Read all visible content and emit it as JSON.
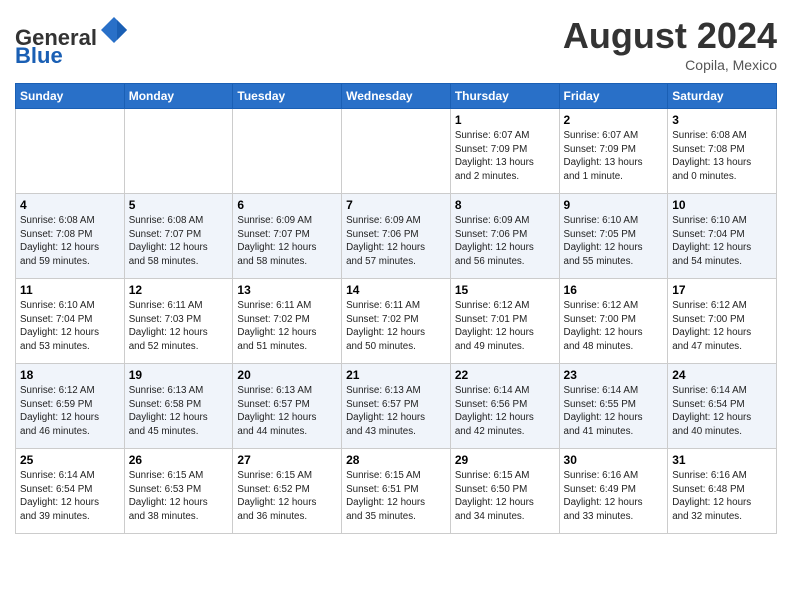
{
  "header": {
    "logo_line1": "General",
    "logo_line2": "Blue",
    "month_year": "August 2024",
    "location": "Copila, Mexico"
  },
  "days_of_week": [
    "Sunday",
    "Monday",
    "Tuesday",
    "Wednesday",
    "Thursday",
    "Friday",
    "Saturday"
  ],
  "weeks": [
    [
      {
        "day": "",
        "info": ""
      },
      {
        "day": "",
        "info": ""
      },
      {
        "day": "",
        "info": ""
      },
      {
        "day": "",
        "info": ""
      },
      {
        "day": "1",
        "info": "Sunrise: 6:07 AM\nSunset: 7:09 PM\nDaylight: 13 hours\nand 2 minutes."
      },
      {
        "day": "2",
        "info": "Sunrise: 6:07 AM\nSunset: 7:09 PM\nDaylight: 13 hours\nand 1 minute."
      },
      {
        "day": "3",
        "info": "Sunrise: 6:08 AM\nSunset: 7:08 PM\nDaylight: 13 hours\nand 0 minutes."
      }
    ],
    [
      {
        "day": "4",
        "info": "Sunrise: 6:08 AM\nSunset: 7:08 PM\nDaylight: 12 hours\nand 59 minutes."
      },
      {
        "day": "5",
        "info": "Sunrise: 6:08 AM\nSunset: 7:07 PM\nDaylight: 12 hours\nand 58 minutes."
      },
      {
        "day": "6",
        "info": "Sunrise: 6:09 AM\nSunset: 7:07 PM\nDaylight: 12 hours\nand 58 minutes."
      },
      {
        "day": "7",
        "info": "Sunrise: 6:09 AM\nSunset: 7:06 PM\nDaylight: 12 hours\nand 57 minutes."
      },
      {
        "day": "8",
        "info": "Sunrise: 6:09 AM\nSunset: 7:06 PM\nDaylight: 12 hours\nand 56 minutes."
      },
      {
        "day": "9",
        "info": "Sunrise: 6:10 AM\nSunset: 7:05 PM\nDaylight: 12 hours\nand 55 minutes."
      },
      {
        "day": "10",
        "info": "Sunrise: 6:10 AM\nSunset: 7:04 PM\nDaylight: 12 hours\nand 54 minutes."
      }
    ],
    [
      {
        "day": "11",
        "info": "Sunrise: 6:10 AM\nSunset: 7:04 PM\nDaylight: 12 hours\nand 53 minutes."
      },
      {
        "day": "12",
        "info": "Sunrise: 6:11 AM\nSunset: 7:03 PM\nDaylight: 12 hours\nand 52 minutes."
      },
      {
        "day": "13",
        "info": "Sunrise: 6:11 AM\nSunset: 7:02 PM\nDaylight: 12 hours\nand 51 minutes."
      },
      {
        "day": "14",
        "info": "Sunrise: 6:11 AM\nSunset: 7:02 PM\nDaylight: 12 hours\nand 50 minutes."
      },
      {
        "day": "15",
        "info": "Sunrise: 6:12 AM\nSunset: 7:01 PM\nDaylight: 12 hours\nand 49 minutes."
      },
      {
        "day": "16",
        "info": "Sunrise: 6:12 AM\nSunset: 7:00 PM\nDaylight: 12 hours\nand 48 minutes."
      },
      {
        "day": "17",
        "info": "Sunrise: 6:12 AM\nSunset: 7:00 PM\nDaylight: 12 hours\nand 47 minutes."
      }
    ],
    [
      {
        "day": "18",
        "info": "Sunrise: 6:12 AM\nSunset: 6:59 PM\nDaylight: 12 hours\nand 46 minutes."
      },
      {
        "day": "19",
        "info": "Sunrise: 6:13 AM\nSunset: 6:58 PM\nDaylight: 12 hours\nand 45 minutes."
      },
      {
        "day": "20",
        "info": "Sunrise: 6:13 AM\nSunset: 6:57 PM\nDaylight: 12 hours\nand 44 minutes."
      },
      {
        "day": "21",
        "info": "Sunrise: 6:13 AM\nSunset: 6:57 PM\nDaylight: 12 hours\nand 43 minutes."
      },
      {
        "day": "22",
        "info": "Sunrise: 6:14 AM\nSunset: 6:56 PM\nDaylight: 12 hours\nand 42 minutes."
      },
      {
        "day": "23",
        "info": "Sunrise: 6:14 AM\nSunset: 6:55 PM\nDaylight: 12 hours\nand 41 minutes."
      },
      {
        "day": "24",
        "info": "Sunrise: 6:14 AM\nSunset: 6:54 PM\nDaylight: 12 hours\nand 40 minutes."
      }
    ],
    [
      {
        "day": "25",
        "info": "Sunrise: 6:14 AM\nSunset: 6:54 PM\nDaylight: 12 hours\nand 39 minutes."
      },
      {
        "day": "26",
        "info": "Sunrise: 6:15 AM\nSunset: 6:53 PM\nDaylight: 12 hours\nand 38 minutes."
      },
      {
        "day": "27",
        "info": "Sunrise: 6:15 AM\nSunset: 6:52 PM\nDaylight: 12 hours\nand 36 minutes."
      },
      {
        "day": "28",
        "info": "Sunrise: 6:15 AM\nSunset: 6:51 PM\nDaylight: 12 hours\nand 35 minutes."
      },
      {
        "day": "29",
        "info": "Sunrise: 6:15 AM\nSunset: 6:50 PM\nDaylight: 12 hours\nand 34 minutes."
      },
      {
        "day": "30",
        "info": "Sunrise: 6:16 AM\nSunset: 6:49 PM\nDaylight: 12 hours\nand 33 minutes."
      },
      {
        "day": "31",
        "info": "Sunrise: 6:16 AM\nSunset: 6:48 PM\nDaylight: 12 hours\nand 32 minutes."
      }
    ]
  ]
}
